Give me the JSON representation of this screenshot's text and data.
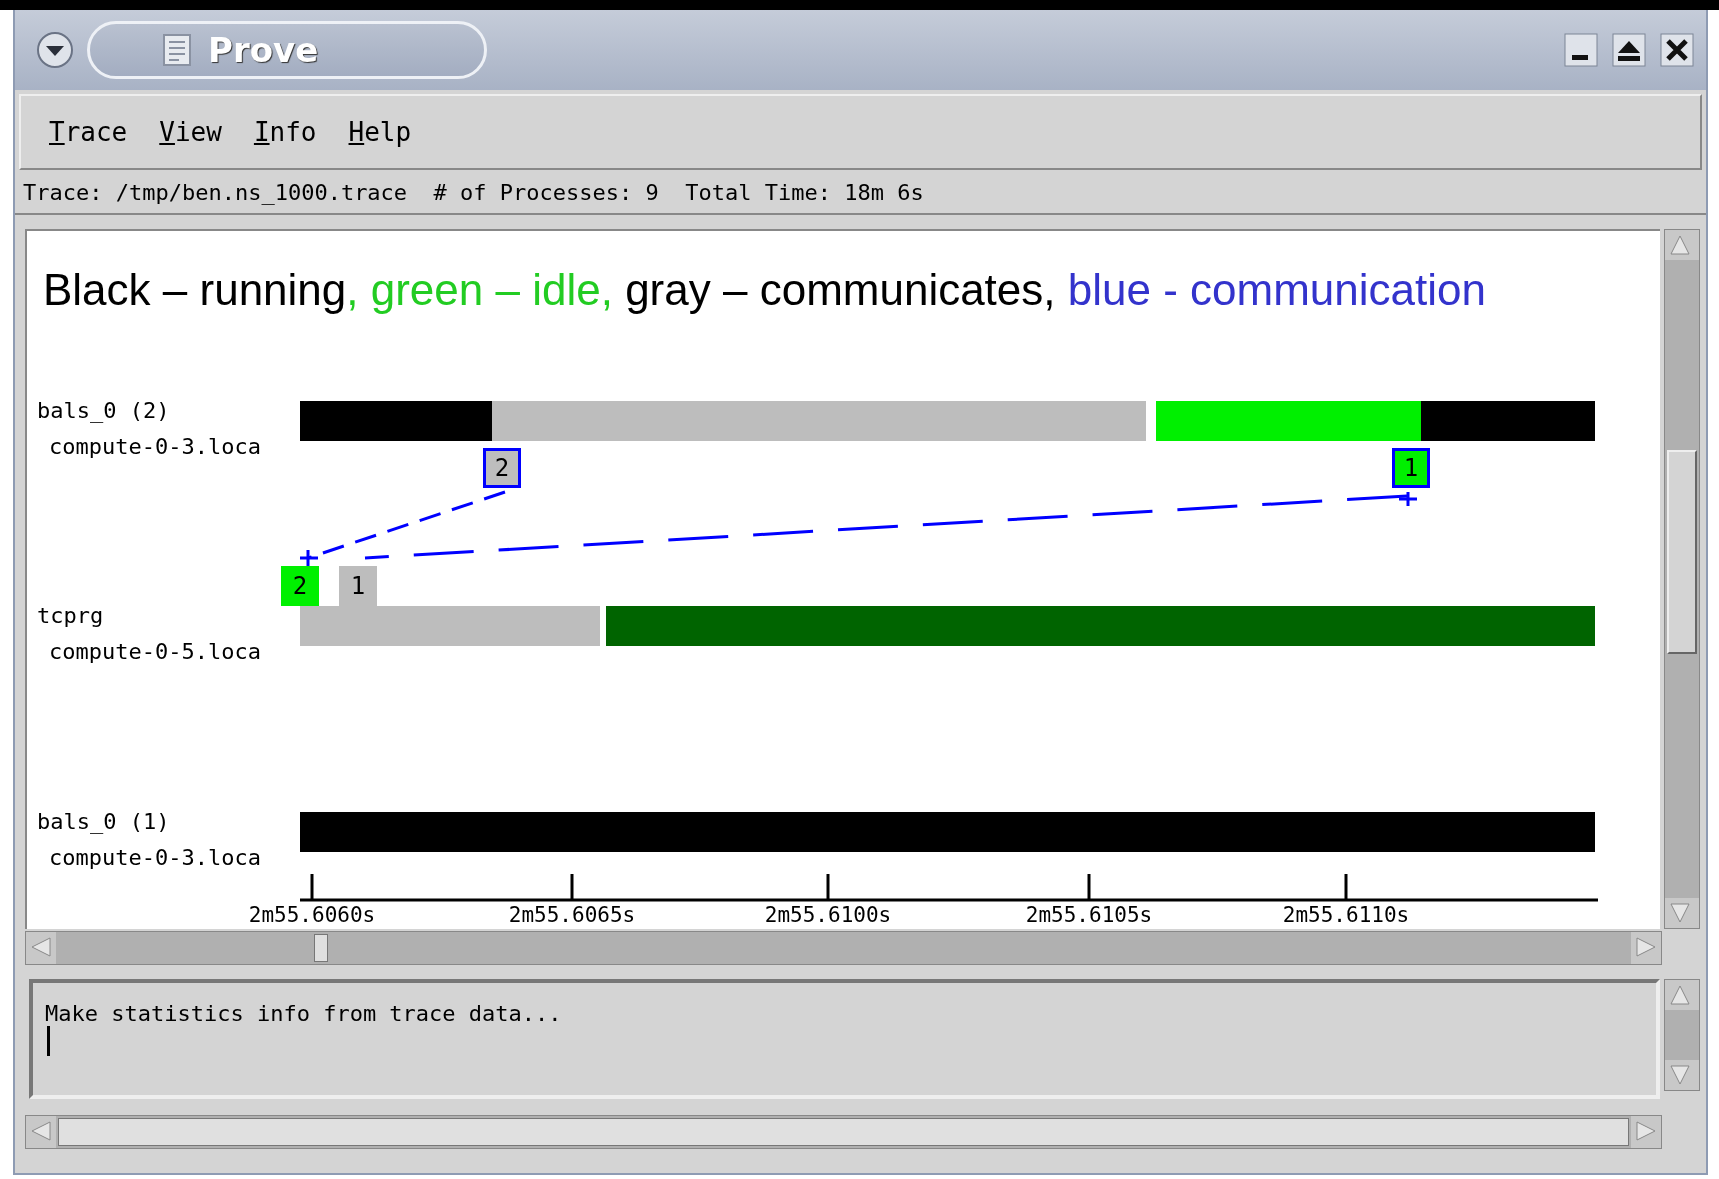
{
  "window": {
    "title": "Prove"
  },
  "menu": [
    {
      "label": "Trace"
    },
    {
      "label": "View"
    },
    {
      "label": "Info"
    },
    {
      "label": "Help"
    }
  ],
  "status_line": "Trace: /tmp/ben.ns_1000.trace  # of Processes: 9  Total Time: 18m 6s",
  "legend": [
    {
      "text": "Black – running",
      "color": "#000000"
    },
    {
      "text": ", green – idle,",
      "color": "#22cc22"
    },
    {
      "text": " gray – communicates,",
      "color": "#000000"
    },
    {
      "text": " blue - communication",
      "color": "#3333cc"
    }
  ],
  "timeline": {
    "processes": [
      {
        "name": "bals_0 (2)",
        "host": "compute-0-3.loca",
        "segments": [
          {
            "kind": "running"
          },
          {
            "kind": "communicates"
          },
          {
            "kind": "gap"
          },
          {
            "kind": "idle"
          },
          {
            "kind": "running"
          }
        ]
      },
      {
        "name": "tcprg",
        "host": "compute-0-5.loca",
        "segments": [
          {
            "kind": "communicates"
          },
          {
            "kind": "gap"
          },
          {
            "kind": "waiting"
          }
        ]
      },
      {
        "name": "bals_0 (1)",
        "host": "compute-0-3.loca",
        "segments": [
          {
            "kind": "running"
          }
        ]
      }
    ],
    "messages": [
      {
        "label": "2",
        "kind": "communicates",
        "selected": true
      },
      {
        "label": "1",
        "kind": "idle",
        "selected": true
      },
      {
        "label": "2",
        "kind": "idle",
        "selected": false
      },
      {
        "label": "1",
        "kind": "communicates",
        "selected": false
      }
    ],
    "ticks": [
      "2m55.6060s",
      "2m55.6065s",
      "2m55.6100s",
      "2m55.6105s",
      "2m55.6110s"
    ]
  },
  "log": {
    "text": "Make statistics info from trace data..."
  }
}
